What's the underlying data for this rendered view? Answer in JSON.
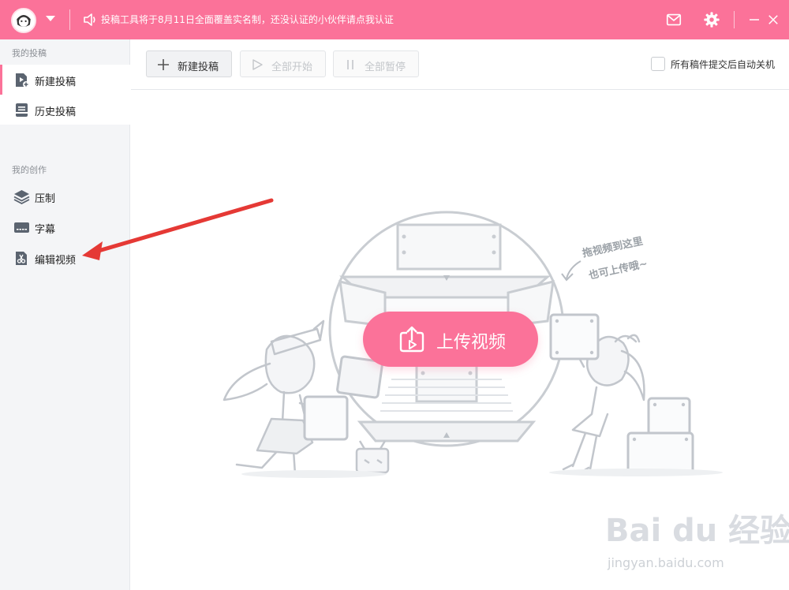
{
  "titlebar": {
    "notice": "投稿工具将于8月11日全面覆盖实名制，还没认证的小伙伴请点我认证",
    "icons": [
      "avatar",
      "chevron-down-icon",
      "speaker-icon",
      "mail-icon",
      "gear-icon",
      "minimize-icon",
      "close-icon"
    ],
    "accent": "#fb7299"
  },
  "sidebar": {
    "section1": "我的投稿",
    "items1": [
      {
        "label": "新建投稿",
        "icon": "new-upload-icon",
        "active": true
      },
      {
        "label": "历史投稿",
        "icon": "history-icon"
      }
    ],
    "section2": "我的创作",
    "items2": [
      {
        "label": "压制",
        "icon": "layers-icon"
      },
      {
        "label": "字幕",
        "icon": "subtitle-icon"
      },
      {
        "label": "编辑视频",
        "icon": "scissors-icon"
      }
    ]
  },
  "toolbar": {
    "new_label": "新建投稿",
    "start_all_label": "全部开始",
    "pause_all_label": "全部暂停",
    "auto_shutdown_label": "所有稿件提交后自动关机",
    "auto_shutdown_checked": false
  },
  "main": {
    "upload_label": "上传视频",
    "drag_hint_line1": "拖视频到这里",
    "drag_hint_line2": "也可上传哦~"
  },
  "watermark": {
    "logo": "Bai du 经验",
    "url": "jingyan.baidu.com"
  }
}
